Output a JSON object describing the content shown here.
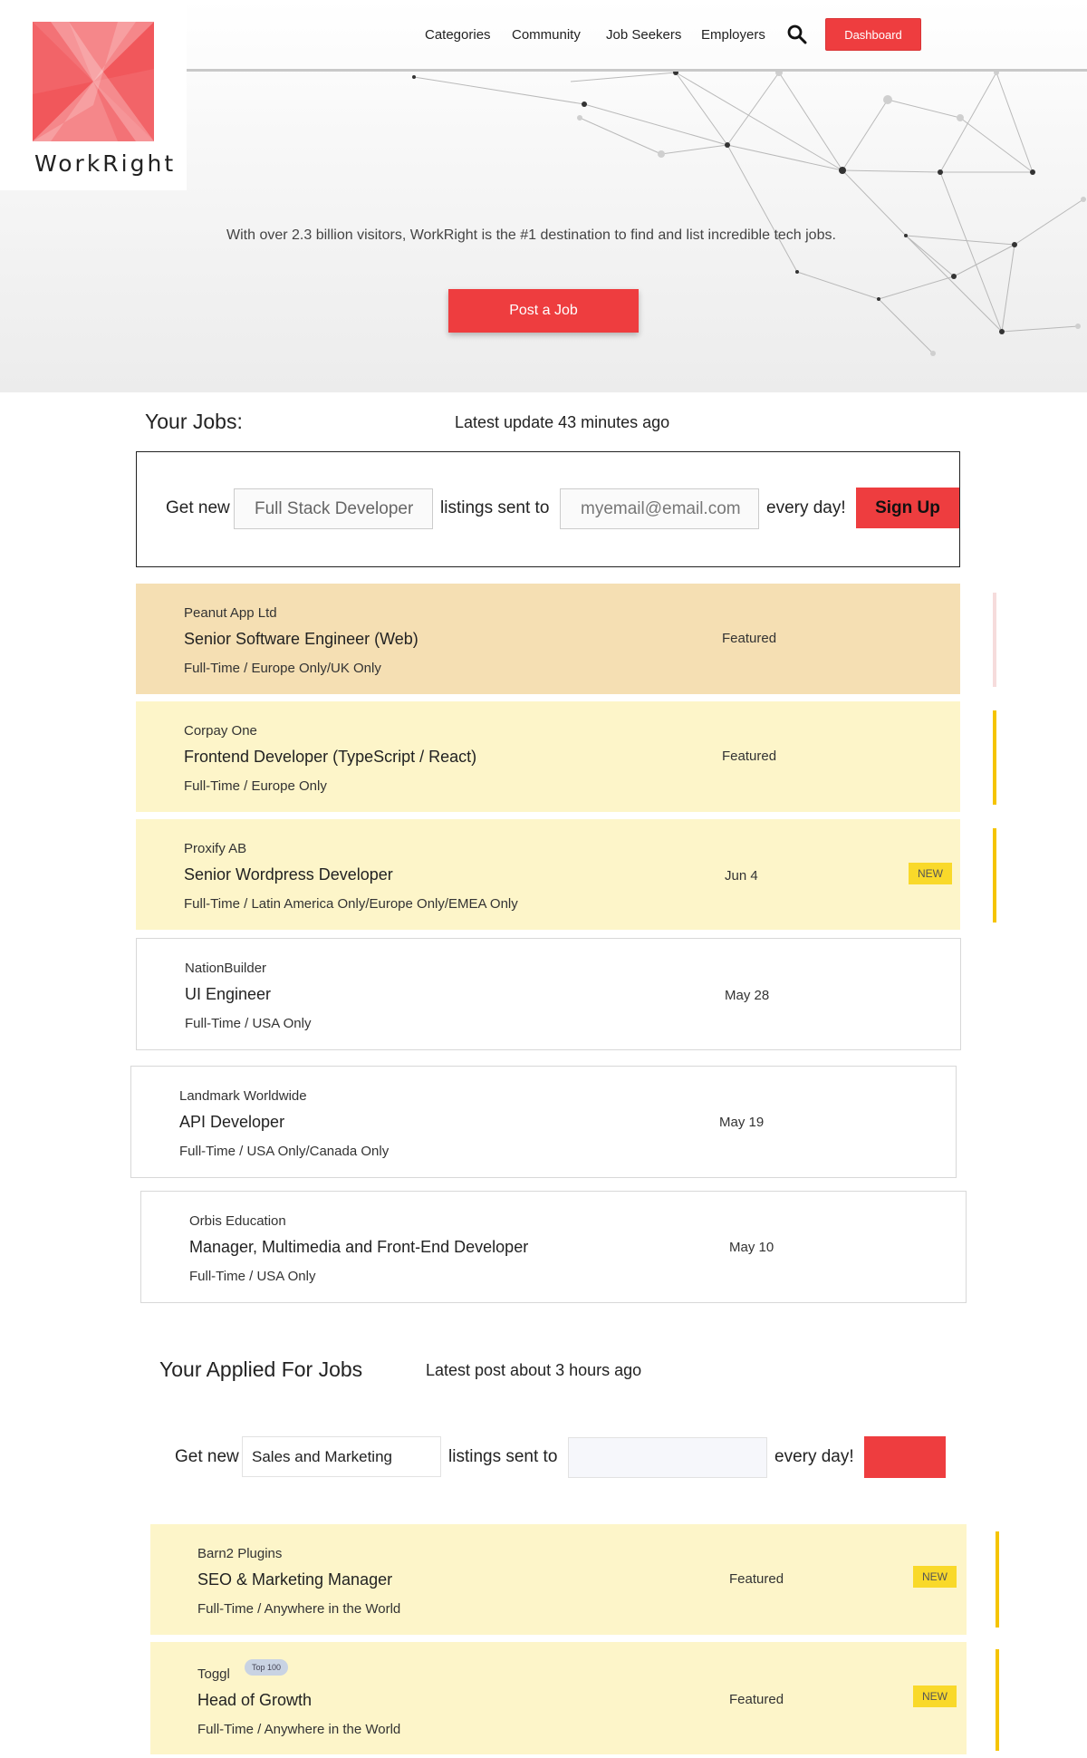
{
  "header": {
    "logo_text": "WorkRight",
    "nav": [
      "Categories",
      "Community",
      "Job Seekers",
      "Employers"
    ],
    "dashboard_label": "Dashboard"
  },
  "hero": {
    "tagline": "With over 2.3 billion visitors, WorkRight is the #1 destination to find and list incredible tech jobs.",
    "post_job_label": "Post a Job"
  },
  "your_jobs": {
    "title": "Your Jobs:",
    "update": "Latest update 43 minutes ago",
    "alert": {
      "prefix": "Get new",
      "keyword_value": "Full Stack Developer",
      "middle": "listings sent to",
      "email_placeholder": "myemail@email.com",
      "suffix": "every day!",
      "button": "Sign Up"
    },
    "jobs": [
      {
        "company": "Peanut App Ltd",
        "title": "Senior Software Engineer (Web)",
        "meta": "Full-Time / Europe Only/UK Only",
        "right": "Featured",
        "new": ""
      },
      {
        "company": "Corpay One",
        "title": "Frontend Developer (TypeScript / React)",
        "meta": "Full-Time / Europe Only",
        "right": "Featured",
        "new": ""
      },
      {
        "company": "Proxify AB",
        "title": "Senior Wordpress Developer",
        "meta": "Full-Time / Latin America Only/Europe Only/EMEA Only",
        "right": "Jun 4",
        "new": "NEW"
      },
      {
        "company": "NationBuilder",
        "title": "UI Engineer",
        "meta": "Full-Time / USA Only",
        "right": "May 28",
        "new": ""
      },
      {
        "company": "Landmark Worldwide",
        "title": "API Developer",
        "meta": "Full-Time / USA Only/Canada Only",
        "right": "May 19",
        "new": ""
      },
      {
        "company": "Orbis Education",
        "title": "Manager, Multimedia and Front-End Developer",
        "meta": "Full-Time / USA Only",
        "right": "May 10",
        "new": ""
      }
    ]
  },
  "applied_jobs": {
    "title": "Your Applied For Jobs",
    "update": "Latest post about 3 hours ago",
    "alert": {
      "prefix": "Get new",
      "keyword_value": "Sales and Marketing",
      "middle": "listings sent to",
      "email_placeholder": "",
      "suffix": "every day!",
      "button": ""
    },
    "jobs": [
      {
        "company": "Barn2 Plugins",
        "title": "SEO & Marketing Manager",
        "meta": "Full-Time / Anywhere in the World",
        "right": "Featured",
        "new": "NEW",
        "pill": ""
      },
      {
        "company": "Toggl",
        "title": "Head of Growth",
        "meta": "Full-Time / Anywhere in the World",
        "right": "Featured",
        "new": "NEW",
        "pill": "Top 100"
      }
    ]
  },
  "colors": {
    "accent_red": "#ee3d3f",
    "featured_tan": "#f5dfb3",
    "featured_yellow": "#fdf5c9",
    "new_badge": "#f9d92a",
    "side_bar_yellow": "#f5c400",
    "side_bar_pink": "#f6dcdc"
  },
  "icons": [
    "search-icon",
    "logo-mark-icon",
    "network-decoration"
  ]
}
